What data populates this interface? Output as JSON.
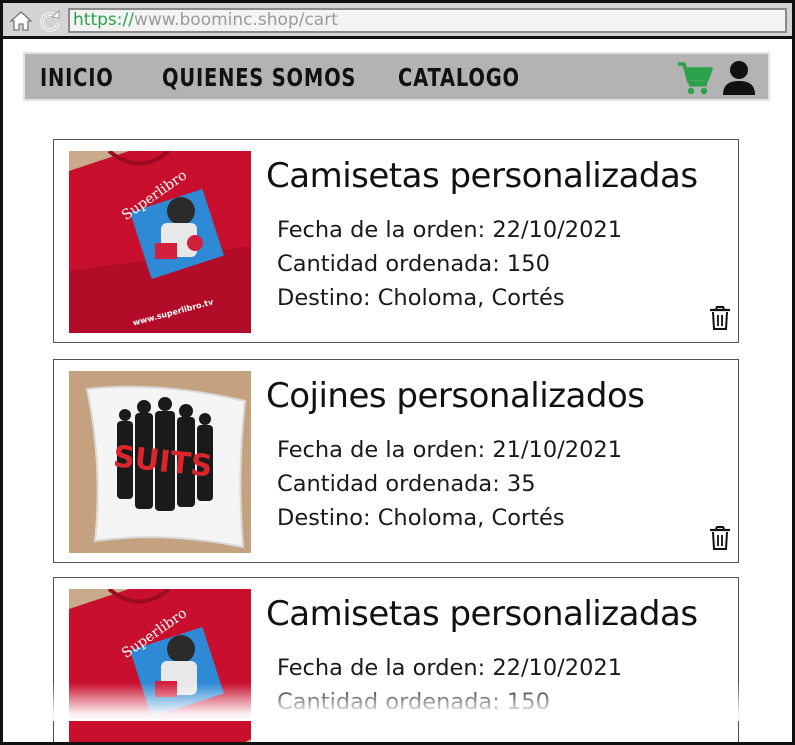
{
  "browser": {
    "url_scheme": "https",
    "url_sep": "://",
    "url_host": "www.boominc.shop/cart"
  },
  "nav": {
    "items": [
      {
        "label": "INICIO"
      },
      {
        "label": "QUIENES SOMOS"
      },
      {
        "label": "CATALOGO"
      }
    ],
    "icons": [
      "shopping-cart-icon",
      "user-icon"
    ],
    "cart_color": "#2aa14a"
  },
  "orders": [
    {
      "title": "Camisetas personalizadas",
      "date_line": "Fecha de la orden: 22/10/2021",
      "qty_line": "Cantidad ordenada: 150",
      "dest_line": "Destino: Choloma, Cortés",
      "image": "red-tshirt",
      "image_text": "Superlibro",
      "image_url_text": "www.superlibro.tv"
    },
    {
      "title": "Cojines personalizados",
      "date_line": "Fecha de la orden: 21/10/2021",
      "qty_line": "Cantidad ordenada: 35",
      "dest_line": "Destino: Choloma, Cortés",
      "image": "suits-pillow",
      "image_text": "SUITS"
    },
    {
      "title": "Camisetas personalizadas",
      "date_line": "Fecha de la orden: 22/10/2021",
      "qty_line": "Cantidad ordenada: 150",
      "dest_line": "",
      "image": "red-tshirt",
      "image_text": "Superlibro"
    }
  ]
}
